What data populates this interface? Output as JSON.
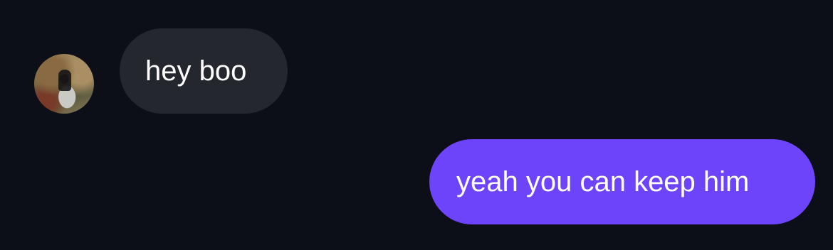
{
  "messages": [
    {
      "direction": "incoming",
      "text": "hey boo",
      "has_avatar": true,
      "bubble_color": "#24272d"
    },
    {
      "direction": "outgoing",
      "text": "yeah you can keep him",
      "bubble_color": "#6d44fa"
    }
  ],
  "colors": {
    "background": "#0c0f17",
    "text": "#ffffff"
  }
}
